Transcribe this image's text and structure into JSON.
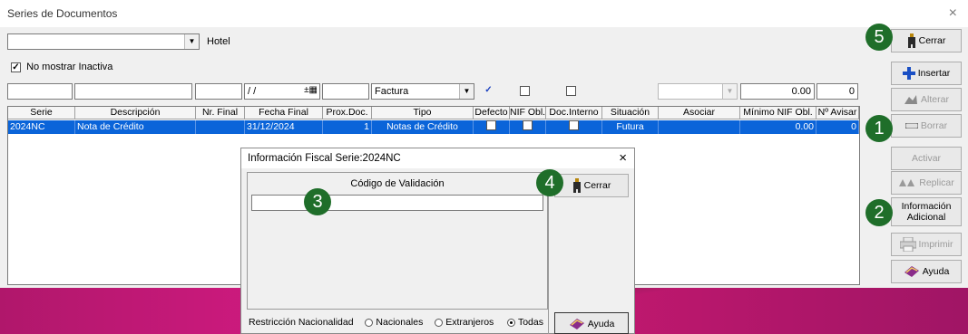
{
  "window": {
    "title": "Series de Documentos",
    "close": "×"
  },
  "hotel_combo": {
    "value": "",
    "label": "Hotel"
  },
  "no_mostrar": {
    "label": "No mostrar Inactiva",
    "checked": "✓"
  },
  "filters": {
    "fecha": "/ /",
    "tipo": "Factura",
    "defecto_check": "✓",
    "minimo": "0.00",
    "avisar": "0"
  },
  "columns": [
    "Serie",
    "Descripción",
    "Nr. Final",
    "Fecha Final",
    "Prox.Doc.",
    "Tipo",
    "Defecto",
    "NIF Obl.",
    "Doc.Interno",
    "Situación",
    "Asociar",
    "Mínimo NIF Obl.",
    "Nº Avisar"
  ],
  "row": {
    "serie": "2024NC",
    "descripcion": "Nota de Crédito",
    "nr_final": "",
    "fecha_final": "31/12/2024",
    "prox_doc": "1",
    "tipo": "Notas de Crédito",
    "situacion": "Futura",
    "asociar": "",
    "minimo": "0.00",
    "avisar": "0"
  },
  "side_buttons": {
    "cerrar": "Cerrar",
    "insertar": "Insertar",
    "alterar": "Alterar",
    "borrar": "Borrar",
    "activar": "Activar",
    "replicar": "Replicar",
    "info_line1": "Información",
    "info_line2": "Adicional",
    "imprimir": "Imprimir",
    "ayuda": "Ayuda"
  },
  "badges": [
    "1",
    "2",
    "3",
    "4",
    "5"
  ],
  "dialog": {
    "title": "Información Fiscal Serie:2024NC",
    "close": "×",
    "codigo_label": "Código de Validación",
    "codigo_value": "",
    "cerrar": "Cerrar",
    "restriccion_label": "Restricción Nacionalidad",
    "opt_nacionales": "Nacionales",
    "opt_extranjeros": "Extranjeros",
    "opt_todas": "Todas",
    "ayuda": "Ayuda"
  },
  "colors": {
    "selection": "#0a64d9",
    "badge": "#1f6e2a",
    "brand_pink": "#c2186f"
  },
  "icons": [
    "close-icon",
    "person-exit-icon",
    "plus-cross-icon",
    "edit-pencil-icon",
    "minus-icon",
    "replicate-icon",
    "printer-icon",
    "help-book-icon",
    "calendar-icon"
  ]
}
